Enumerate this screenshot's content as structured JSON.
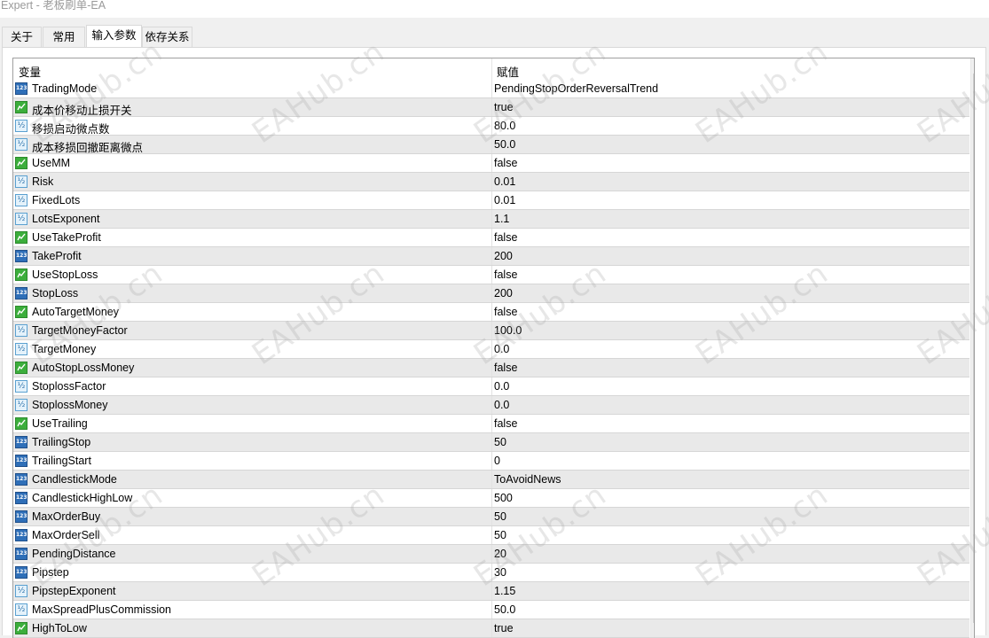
{
  "window": {
    "title": "Expert - 老板刷单-EA"
  },
  "tabs": [
    {
      "label": "关于",
      "active": false
    },
    {
      "label": "常用",
      "active": false
    },
    {
      "label": "输入参数",
      "active": true
    },
    {
      "label": "依存关系",
      "active": false
    }
  ],
  "table": {
    "headers": {
      "variable": "变量",
      "value": "赋值"
    },
    "rows": [
      {
        "icon": "int-icon",
        "name": "TradingMode",
        "value": "PendingStopOrderReversalTrend"
      },
      {
        "icon": "bool-icon",
        "name": "成本价移动止损开关",
        "value": "true"
      },
      {
        "icon": "double-icon",
        "name": "移损启动微点数",
        "value": "80.0"
      },
      {
        "icon": "double-icon",
        "name": "成本移损回撤距离微点",
        "value": "50.0"
      },
      {
        "icon": "bool-icon",
        "name": "UseMM",
        "value": "false"
      },
      {
        "icon": "double-icon",
        "name": "Risk",
        "value": "0.01"
      },
      {
        "icon": "double-icon",
        "name": "FixedLots",
        "value": "0.01"
      },
      {
        "icon": "double-icon",
        "name": "LotsExponent",
        "value": "1.1"
      },
      {
        "icon": "bool-icon",
        "name": "UseTakeProfit",
        "value": "false"
      },
      {
        "icon": "int-icon",
        "name": "TakeProfit",
        "value": "200"
      },
      {
        "icon": "bool-icon",
        "name": "UseStopLoss",
        "value": "false"
      },
      {
        "icon": "int-icon",
        "name": "StopLoss",
        "value": "200"
      },
      {
        "icon": "bool-icon",
        "name": "AutoTargetMoney",
        "value": "false"
      },
      {
        "icon": "double-icon",
        "name": "TargetMoneyFactor",
        "value": "100.0"
      },
      {
        "icon": "double-icon",
        "name": "TargetMoney",
        "value": "0.0"
      },
      {
        "icon": "bool-icon",
        "name": "AutoStopLossMoney",
        "value": "false"
      },
      {
        "icon": "double-icon",
        "name": "StoplossFactor",
        "value": "0.0"
      },
      {
        "icon": "double-icon",
        "name": "StoplossMoney",
        "value": "0.0"
      },
      {
        "icon": "bool-icon",
        "name": "UseTrailing",
        "value": "false"
      },
      {
        "icon": "int-icon",
        "name": "TrailingStop",
        "value": "50"
      },
      {
        "icon": "int-icon",
        "name": "TrailingStart",
        "value": "0"
      },
      {
        "icon": "int-icon",
        "name": "CandlestickMode",
        "value": "ToAvoidNews"
      },
      {
        "icon": "int-icon",
        "name": "CandlestickHighLow",
        "value": "500"
      },
      {
        "icon": "int-icon",
        "name": "MaxOrderBuy",
        "value": "50"
      },
      {
        "icon": "int-icon",
        "name": "MaxOrderSell",
        "value": "50"
      },
      {
        "icon": "int-icon",
        "name": "PendingDistance",
        "value": "20"
      },
      {
        "icon": "int-icon",
        "name": "Pipstep",
        "value": "30"
      },
      {
        "icon": "double-icon",
        "name": "PipstepExponent",
        "value": "1.15"
      },
      {
        "icon": "double-icon",
        "name": "MaxSpreadPlusCommission",
        "value": "50.0"
      },
      {
        "icon": "bool-icon",
        "name": "HighToLow",
        "value": "true"
      }
    ]
  },
  "watermark": {
    "text": "EAHub.cn"
  },
  "colors": {
    "int_icon": "#2f6fb8",
    "double_icon": "#e4f2fb",
    "bool_icon": "#3cae3c",
    "row_alt": "#e9e9e9"
  }
}
